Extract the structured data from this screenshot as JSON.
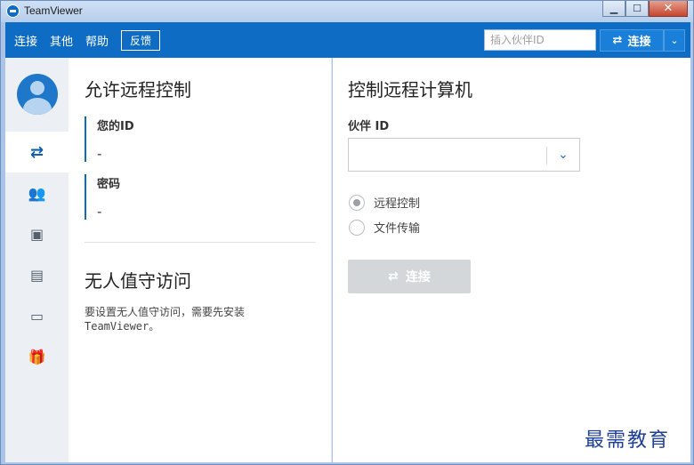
{
  "window": {
    "title": "TeamViewer",
    "controls": {
      "minimize": "▁",
      "maximize": "☐",
      "close": "✕"
    }
  },
  "toolbar": {
    "menu": [
      "连接",
      "其他",
      "帮助"
    ],
    "feedback_label": "反馈",
    "partner_id_placeholder": "插入伙伴ID",
    "connect_label": "连接",
    "connect_icon": "⇄",
    "dropdown_icon": "⌄"
  },
  "sidebar": {
    "items": [
      {
        "name": "remote-control",
        "icon": "⇄"
      },
      {
        "name": "meeting",
        "icon": "👥"
      },
      {
        "name": "contacts",
        "icon": "▣"
      },
      {
        "name": "chat",
        "icon": "▤"
      },
      {
        "name": "augmented-reality",
        "icon": "▭"
      },
      {
        "name": "gift",
        "icon": "🎁"
      }
    ]
  },
  "left": {
    "allow_title": "允许远程控制",
    "your_id_label": "您的ID",
    "your_id_value": "-",
    "password_label": "密码",
    "password_value": "-",
    "unattended_title": "无人值守访问",
    "unattended_desc_line1": "要设置无人值守访问，需要先安装",
    "unattended_desc_line2": "TeamViewer。"
  },
  "right": {
    "control_title": "控制远程计算机",
    "partner_id_label": "伙伴 ID",
    "partner_id_value": "",
    "partner_dropdown_icon": "⌄",
    "options": [
      {
        "label": "远程控制",
        "checked": true
      },
      {
        "label": "文件传输",
        "checked": false
      }
    ],
    "connect_label": "连接",
    "connect_icon": "⇄"
  },
  "watermark": "最需教育"
}
